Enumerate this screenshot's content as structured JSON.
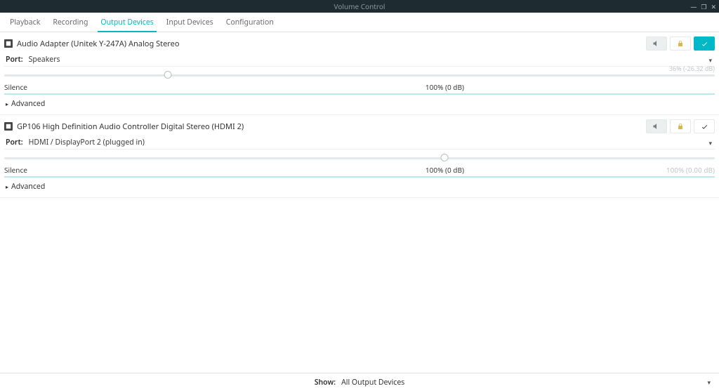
{
  "window": {
    "title": "Volume Control"
  },
  "tabs": {
    "playback": "Playback",
    "recording": "Recording",
    "output_devices": "Output Devices",
    "input_devices": "Input Devices",
    "configuration": "Configuration",
    "active": "output_devices"
  },
  "devices": [
    {
      "name": "Audio Adapter (Unitek Y-247A) Analog Stereo",
      "port_label": "Port:",
      "port_value": "Speakers",
      "slider_percent": 23,
      "center_label": "100% (0 dB)",
      "silence_label": "Silence",
      "max_label": "36% (-26.32 dB)",
      "right_scale": "",
      "advanced_label": "Advanced",
      "default": true
    },
    {
      "name": "GP106 High Definition Audio Controller Digital Stereo (HDMI 2)",
      "port_label": "Port:",
      "port_value": "HDMI / DisplayPort 2 (plugged in)",
      "slider_percent": 62,
      "center_label": "100% (0 dB)",
      "silence_label": "Silence",
      "max_label": "",
      "right_scale": "100% (0.00 dB)",
      "advanced_label": "Advanced",
      "default": false
    }
  ],
  "footer": {
    "show_label": "Show:",
    "show_value": "All Output Devices"
  }
}
